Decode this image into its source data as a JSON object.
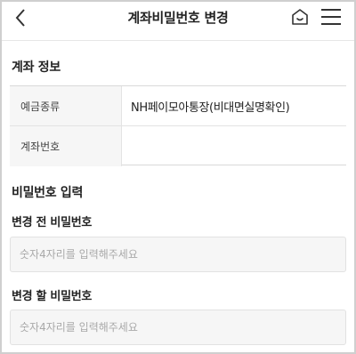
{
  "header": {
    "title": "계좌비밀번호 변경",
    "back_icon": "chevron-left-icon",
    "home_icon": "home-icon",
    "menu_icon": "hamburger-menu-icon"
  },
  "account_info": {
    "section_title": "계좌 정보",
    "rows": [
      {
        "label": "예금종류",
        "value": "NH페이모아통장(비대면실명확인)"
      },
      {
        "label": "계좌번호",
        "value": ""
      }
    ]
  },
  "password": {
    "section_title": "비밀번호 입력",
    "current": {
      "label": "변경 전 비밀번호",
      "placeholder": "숫자4자리를 입력해주세요",
      "value": ""
    },
    "new": {
      "label": "변경 할 비밀번호",
      "placeholder": "숫자4자리를 입력해주세요",
      "value": ""
    }
  }
}
